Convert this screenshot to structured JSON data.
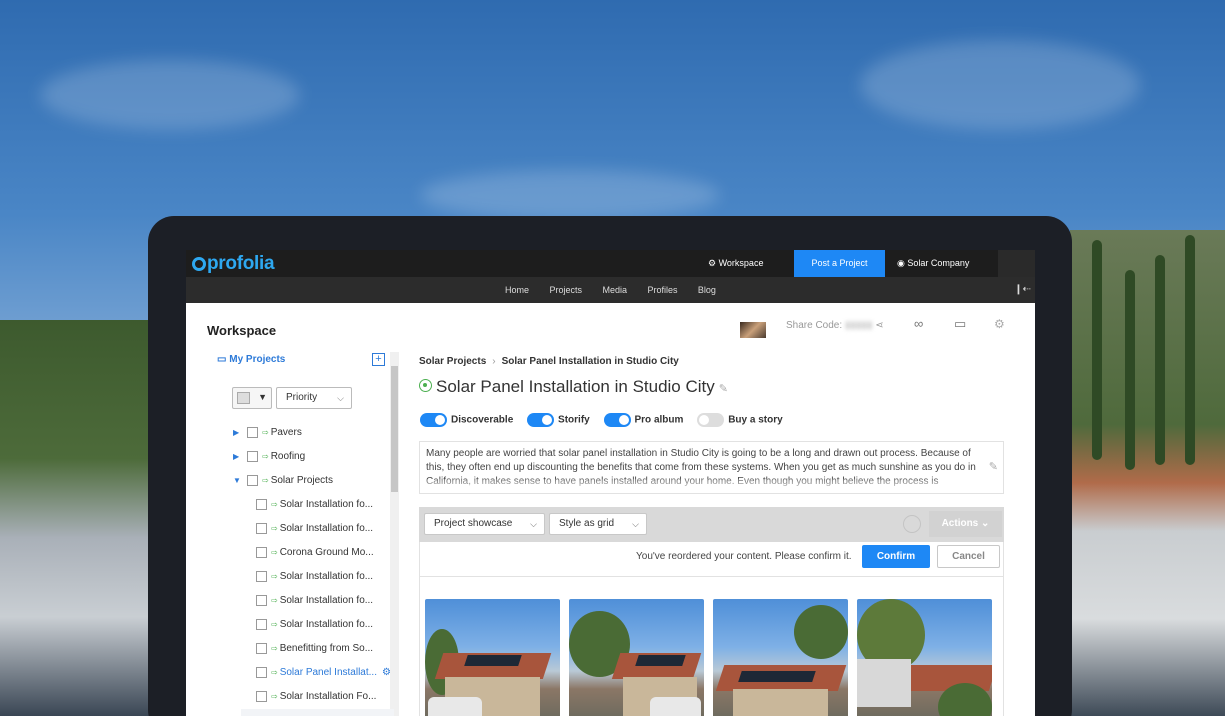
{
  "app": {
    "logo_text": "profolia",
    "brand_color": "#1e88f5"
  },
  "topbar": {
    "workspace_label": "Workspace",
    "post_label": "Post a Project",
    "user_label": "Solar Company"
  },
  "nav": {
    "items": [
      "Home",
      "Projects",
      "Media",
      "Profiles",
      "Blog"
    ]
  },
  "workspace": {
    "title": "Workspace",
    "share_code_label": "Share Code:"
  },
  "sidebar": {
    "my_projects": "My Projects",
    "priority_select": "Priority",
    "tree": [
      {
        "label": "Pavers",
        "level": 0,
        "expanded": false
      },
      {
        "label": "Roofing",
        "level": 0,
        "expanded": false
      },
      {
        "label": "Solar Projects",
        "level": 0,
        "expanded": true
      },
      {
        "label": "Solar Installation fo...",
        "level": 1
      },
      {
        "label": "Solar Installation fo...",
        "level": 1
      },
      {
        "label": "Corona Ground Mo...",
        "level": 1
      },
      {
        "label": "Solar Installation fo...",
        "level": 1
      },
      {
        "label": "Solar Installation fo...",
        "level": 1
      },
      {
        "label": "Solar Installation fo...",
        "level": 1
      },
      {
        "label": "Benefitting from So...",
        "level": 1
      },
      {
        "label": "Solar Panel Installat...",
        "level": 1,
        "active": true
      },
      {
        "label": "Solar Installation Fo...",
        "level": 1
      }
    ]
  },
  "main": {
    "breadcrumb": [
      "Solar Projects",
      "Solar Panel Installation in Studio City"
    ],
    "title": "Solar Panel Installation in Studio City",
    "toggles": [
      {
        "label": "Discoverable",
        "on": true
      },
      {
        "label": "Storify",
        "on": true
      },
      {
        "label": "Pro album",
        "on": true
      },
      {
        "label": "Buy a story",
        "on": false
      }
    ],
    "description": "Many people are worried that solar panel installation in Studio City is going to be a long and drawn out process. Because of this, they often end up discounting the benefits that come from these systems. When you get as much sunshine as you do in California, it makes sense to have panels installed around your home. Even though you might believe the process is",
    "toolbar": {
      "view_select": "Project showcase",
      "style_select": "Style as grid",
      "actions_label": "Actions"
    },
    "reorder": {
      "message": "You've reordered your content. Please confirm it.",
      "confirm_label": "Confirm",
      "cancel_label": "Cancel"
    }
  }
}
